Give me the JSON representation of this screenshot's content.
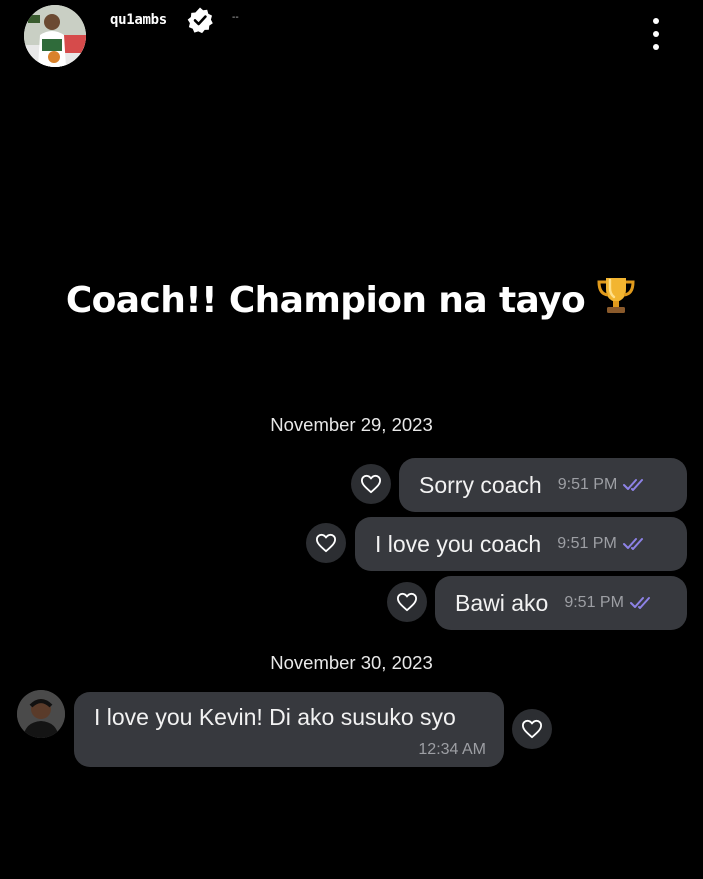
{
  "header": {
    "username": "qu1ambs",
    "verified": true,
    "dash": "--",
    "avatar_icon": "profile-photo",
    "more_icon": "more-vertical-icon"
  },
  "story": {
    "caption": "Coach!! Champion na tayo",
    "emoji": "trophy"
  },
  "chat": {
    "dates": [
      "November 29, 2023",
      "November 30, 2023"
    ],
    "outgoing": [
      {
        "text": "Sorry coach",
        "time": "9:51 PM",
        "status": "read"
      },
      {
        "text": "I love you coach",
        "time": "9:51 PM",
        "status": "read"
      },
      {
        "text": "Bawi ako",
        "time": "9:51 PM",
        "status": "read"
      }
    ],
    "incoming": [
      {
        "text": "I love you Kevin! Di ako susuko syo",
        "time": "12:34 AM"
      }
    ]
  },
  "colors": {
    "background": "#000000",
    "bubble": "#37393e",
    "read_check": "#8d82e6"
  }
}
